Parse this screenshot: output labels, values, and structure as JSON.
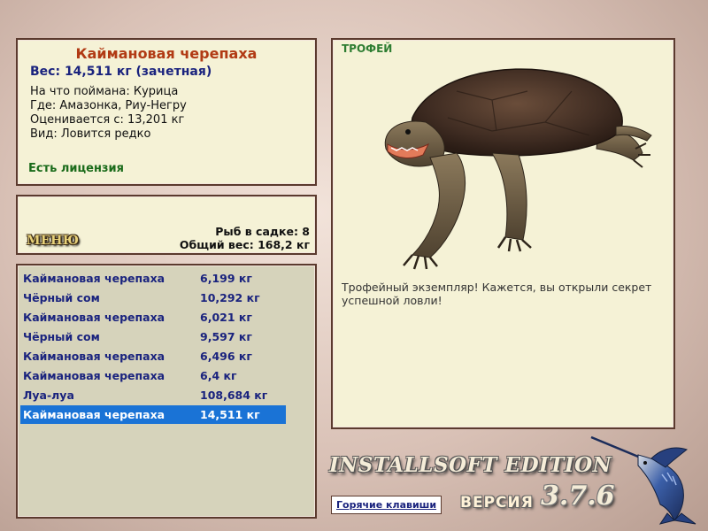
{
  "info": {
    "fish_name": "Каймановая черепаха",
    "weight": "Вес: 14,511 кг (зачетная)",
    "bait": "На что поймана: Курица",
    "location": "Где: Амазонка, Риу-Негру",
    "value": "Оценивается с: 13,201 кг",
    "species": "Вид: Ловится редко",
    "license": "Есть лицензия"
  },
  "menu": {
    "button_label": "МЕНЮ",
    "cage_count": "Рыб в садке: 8",
    "total_weight": "Общий вес: 168,2 кг"
  },
  "catch_list": [
    {
      "name": "Каймановая черепаха",
      "weight": "6,199 кг"
    },
    {
      "name": "Чёрный сом",
      "weight": "10,292 кг"
    },
    {
      "name": "Каймановая черепаха",
      "weight": "6,021 кг"
    },
    {
      "name": "Чёрный сом",
      "weight": "9,597 кг"
    },
    {
      "name": "Каймановая черепаха",
      "weight": "6,496 кг"
    },
    {
      "name": "Каймановая черепаха",
      "weight": "6,4 кг"
    },
    {
      "name": "Луа-луа",
      "weight": "108,684 кг"
    },
    {
      "name": "Каймановая черепаха",
      "weight": "14,511 кг",
      "selected": true
    }
  ],
  "trophy": {
    "label": "ТРОФЕЙ",
    "description": "Трофейный экземпляр! Кажется, вы открыли секрет успешной ловли!",
    "image_icon": "snapping-turtle"
  },
  "footer": {
    "brand": "INSTALLSOFT EDITION",
    "hotkeys_link": "Горячие клавиши",
    "version_label": "ВЕРСИЯ",
    "version_number": "3.7.6",
    "logo_icon": "marlin-fish"
  },
  "colors": {
    "panel_bg": "#f5f2d6",
    "panel_border": "#5b3a2e",
    "title_red": "#b13a14",
    "list_text": "#1a237e",
    "selection": "#1a73d6",
    "license_green": "#1a6b1a"
  }
}
